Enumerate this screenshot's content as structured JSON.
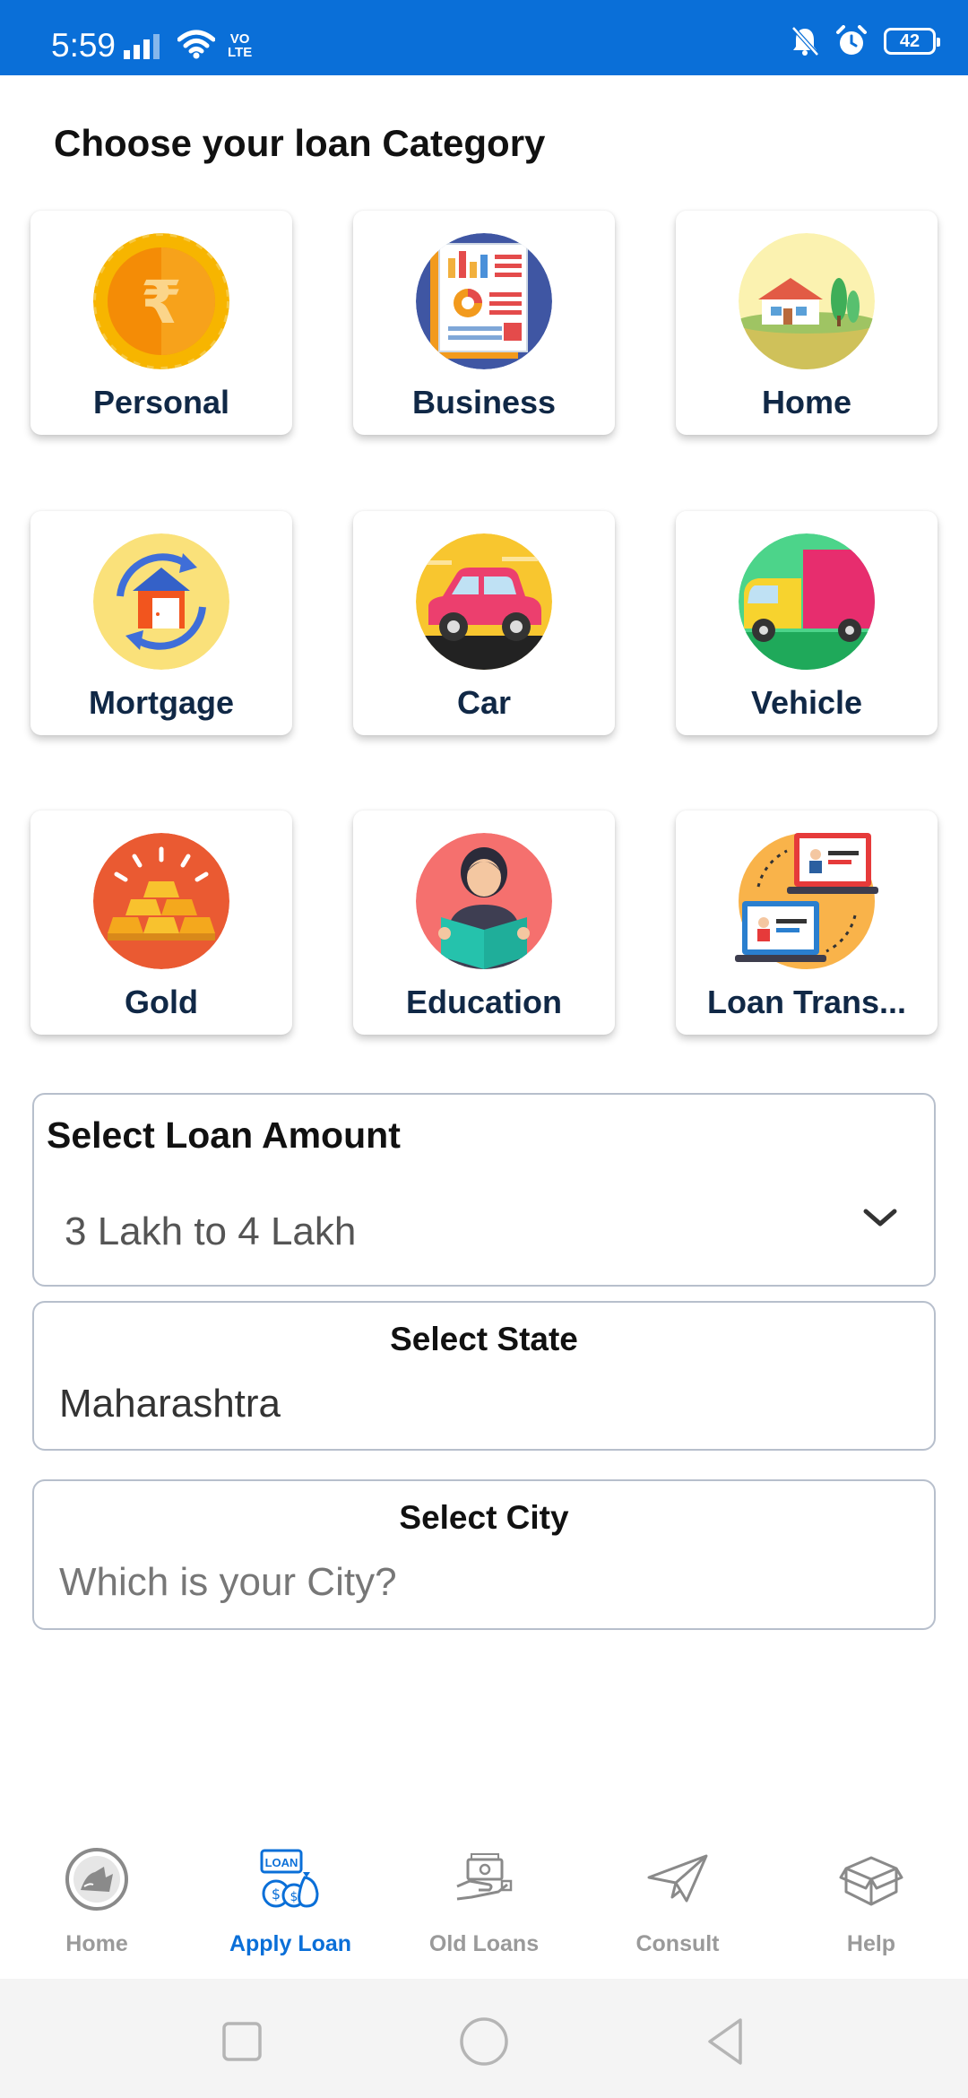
{
  "status_bar": {
    "time": "5:59",
    "volte_line1": "VO",
    "volte_line2": "LTE",
    "battery": "42"
  },
  "page_title": "Choose your loan Category",
  "categories": [
    {
      "label": "Personal",
      "icon": "rupee-coin-icon"
    },
    {
      "label": "Business",
      "icon": "business-report-icon"
    },
    {
      "label": "Home",
      "icon": "house-icon"
    },
    {
      "label": "Mortgage",
      "icon": "mortgage-house-icon"
    },
    {
      "label": "Car",
      "icon": "car-icon"
    },
    {
      "label": "Vehicle",
      "icon": "truck-icon"
    },
    {
      "label": "Gold",
      "icon": "gold-bars-icon"
    },
    {
      "label": "Education",
      "icon": "student-reading-icon"
    },
    {
      "label": "Loan Trans...",
      "icon": "loan-transfer-icon"
    }
  ],
  "loan_amount": {
    "label": "Select Loan Amount",
    "value": "3 Lakh to 4 Lakh"
  },
  "state": {
    "label": "Select State",
    "value": "Maharashtra"
  },
  "city": {
    "label": "Select City",
    "placeholder": "Which is your City?"
  },
  "bottom_nav": [
    {
      "label": "Home",
      "icon": "home-coin-icon",
      "active": false
    },
    {
      "label": "Apply Loan",
      "icon": "apply-loan-icon",
      "active": true
    },
    {
      "label": "Old Loans",
      "icon": "old-loans-icon",
      "active": false
    },
    {
      "label": "Consult",
      "icon": "paper-plane-icon",
      "active": false
    },
    {
      "label": "Help",
      "icon": "help-box-icon",
      "active": false
    }
  ],
  "colors": {
    "brand_blue": "#0a6fd8",
    "label_navy": "#102846",
    "nav_inactive": "#9a9a9a"
  }
}
